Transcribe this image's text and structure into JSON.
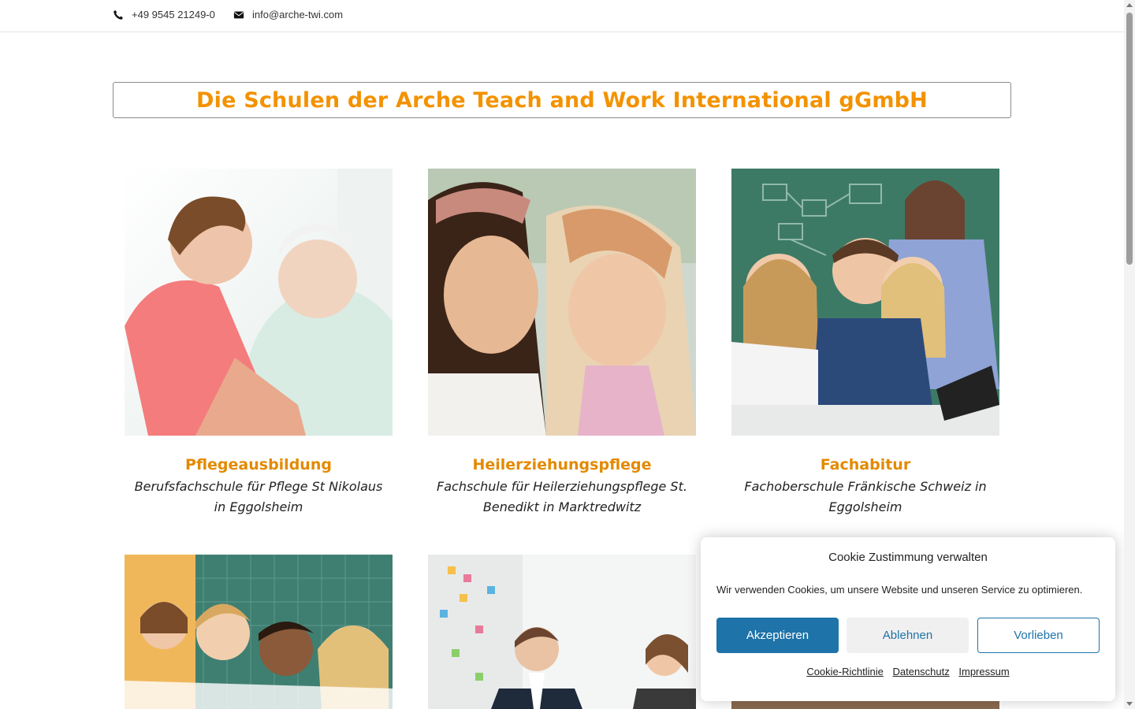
{
  "topbar": {
    "phone": "+49 9545 21249-0",
    "email": "info@arche-twi.com"
  },
  "headline": "Die Schulen der Arche Teach and Work International gGmbH",
  "cards": [
    {
      "title": "Pflegeausbildung",
      "subtitle": "Berufsfachschule für Pflege St Nikolaus in Eggolsheim"
    },
    {
      "title": "Heilerziehungspflege",
      "subtitle": "Fachschule für Heilerziehungspflege St. Benedikt in Marktredwitz"
    },
    {
      "title": "Fachabitur",
      "subtitle": "Fachoberschule Fränkische Schweiz in Eggolsheim"
    }
  ],
  "cookie": {
    "title": "Cookie Zustimmung verwalten",
    "message": "Wir verwenden Cookies, um unsere Website und unseren Service zu optimieren.",
    "accept": "Akzeptieren",
    "deny": "Ablehnen",
    "preferences": "Vorlieben",
    "links": {
      "cookie_policy": "Cookie-Richtlinie",
      "privacy": "Datenschutz",
      "imprint": "Impressum"
    }
  },
  "colors": {
    "accent_orange": "#f39200",
    "button_blue": "#1e73a8"
  },
  "icons": {
    "phone": "phone-icon",
    "email": "envelope-icon"
  }
}
